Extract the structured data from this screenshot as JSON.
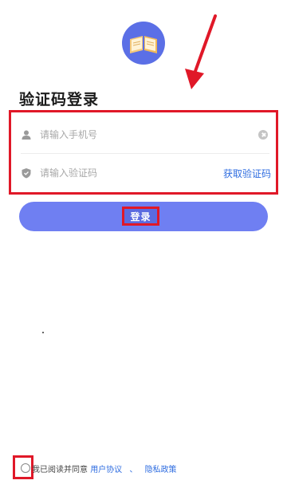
{
  "page": {
    "title": "验证码登录"
  },
  "form": {
    "phone_placeholder": "请输入手机号",
    "code_placeholder": "请输入验证码",
    "get_code_label": "获取验证码"
  },
  "login": {
    "label": "登录"
  },
  "agreement": {
    "prefix": "我已阅读并同意",
    "user_agreement": "用户协议",
    "separator": "、",
    "privacy_policy": "隐私政策"
  },
  "colors": {
    "accent": "#6f7ff2",
    "link": "#2f6de0",
    "highlight": "#e01828",
    "logo_bg": "#5b6fe6"
  },
  "icons": {
    "logo": "book-icon",
    "phone_field": "user-icon",
    "code_field": "shield-icon",
    "clear": "clear-icon",
    "annotation": "red-arrow-icon"
  }
}
